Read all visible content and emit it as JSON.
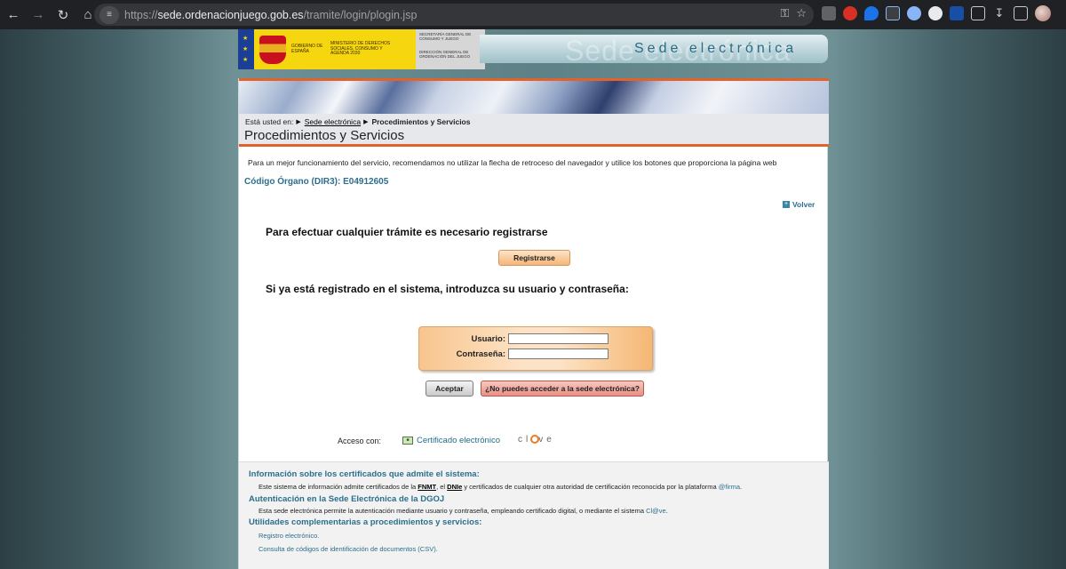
{
  "browser": {
    "url_scheme": "https://",
    "url_host": "sede.ordenacionjuego.gob.es",
    "url_path": "/tramite/login/plogin.jsp"
  },
  "header": {
    "gov_label": "GOBIERNO DE ESPAÑA",
    "ministry_label": "MINISTERIO DE DERECHOS SOCIALES, CONSUMO Y AGENDA 2030",
    "secretariat_label": "SECRETARÍA GENERAL DE CONSUMO Y JUEGO",
    "directorate_label": "DIRECCIÓN GENERAL DE ORDENACIÓN DEL JUEGO",
    "site_title": "Sede electrónica"
  },
  "breadcrumb": {
    "prefix": "Está usted en:",
    "home": "Sede electrónica",
    "current": "Procedimientos y Servicios"
  },
  "page": {
    "title": "Procedimientos y Servicios",
    "notice": "Para un mejor funcionamiento del servicio, recomendamos no utilizar la flecha de retroceso del navegador y utilice los botones que proporciona la página web",
    "dir3": "Código Órgano (DIR3): E04912605",
    "back_label": "Volver",
    "register_heading": "Para efectuar cualquier trámite es necesario registrarse",
    "register_button": "Registrarse",
    "login_heading": "Si ya está registrado en el sistema, introduzca su usuario y contraseña:",
    "user_label": "Usuario:",
    "user_value": "",
    "password_label": "Contraseña:",
    "password_value": "",
    "accept_button": "Aceptar",
    "help_button": "¿No puedes acceder a la sede electrónica?",
    "access_label": "Acceso con:",
    "cert_link": "Certificado electrónico",
    "clave_left": "cl",
    "clave_right": "ve"
  },
  "info": {
    "cert_heading": "Información sobre los certificados que admite el sistema:",
    "cert_text_1": "Este sistema de información admite certificados de la ",
    "cert_fnmt": "FNMT",
    "cert_text_2": ", el ",
    "cert_dnie": "DNIe",
    "cert_text_3": " y certificados de cualquier otra autoridad de certificación reconocida por la plataforma ",
    "cert_firma": "@firma",
    "cert_text_4": ".",
    "auth_heading": "Autenticación en la Sede Electrónica de la DGOJ",
    "auth_text": "Esta sede electrónica permite la autenticación mediante usuario y contraseña, empleando certificado digital, o mediante el sistema ",
    "auth_clave": "Cl@ve",
    "auth_end": ".",
    "util_heading": "Utilidades complementarias a procedimientos y servicios:",
    "util_link_1": "Registro electrónico.",
    "util_link_2": "Consulta de códigos de identificación de documentos (CSV)."
  },
  "colors": {
    "accent_orange": "#e3622a",
    "link_teal": "#2b6f8c"
  }
}
